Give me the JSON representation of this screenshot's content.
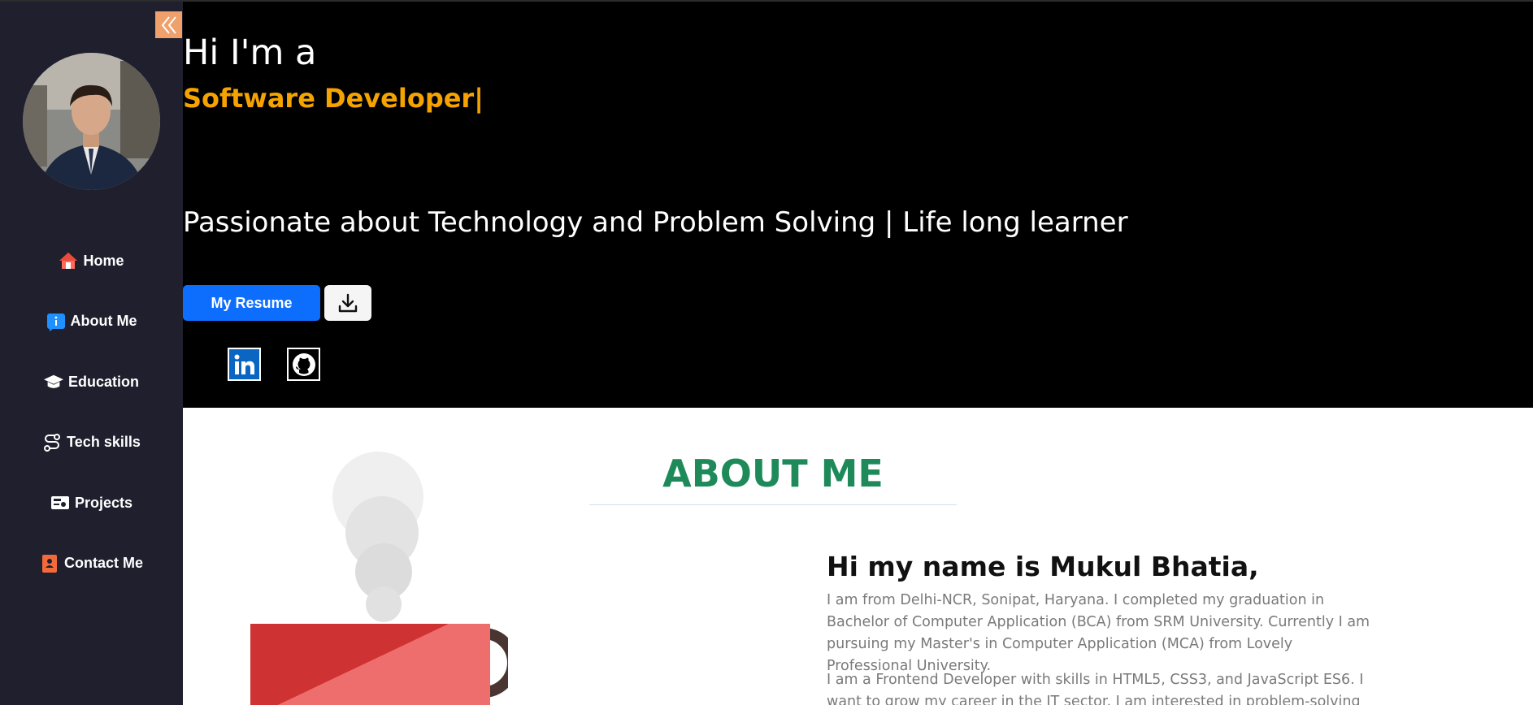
{
  "sidebar": {
    "items": [
      {
        "label": "Home",
        "icon": "home-icon"
      },
      {
        "label": "About Me",
        "icon": "info-icon"
      },
      {
        "label": "Education",
        "icon": "graduation-cap-icon"
      },
      {
        "label": "Tech skills",
        "icon": "route-icon"
      },
      {
        "label": "Projects",
        "icon": "projects-icon"
      },
      {
        "label": "Contact Me",
        "icon": "contact-book-icon"
      }
    ]
  },
  "hero": {
    "greeting": "Hi I'm a",
    "role": "Software Developer|",
    "tagline": "Passionate about Technology and Problem Solving | Life long learner",
    "resume_label": "My Resume"
  },
  "about": {
    "title": "ABOUT ME",
    "name_heading": "Hi my name is Mukul Bhatia,",
    "paragraph1": "I am from Delhi-NCR, Sonipat, Haryana. I completed my graduation in Bachelor of Computer Application (BCA) from SRM University. Currently I am pursuing my Master's in Computer Application (MCA) from Lovely Professional University.",
    "paragraph2": "I am a Frontend Developer with skills in HTML5, CSS3, and JavaScript ES6. I want to grow my career in the IT sector. I am interested in problem-solving and building"
  },
  "colors": {
    "sidebar_bg": "#1f1f2e",
    "accent_orange": "#f5a300",
    "primary_blue": "#0d6efd",
    "about_green": "#1e8a5a"
  }
}
